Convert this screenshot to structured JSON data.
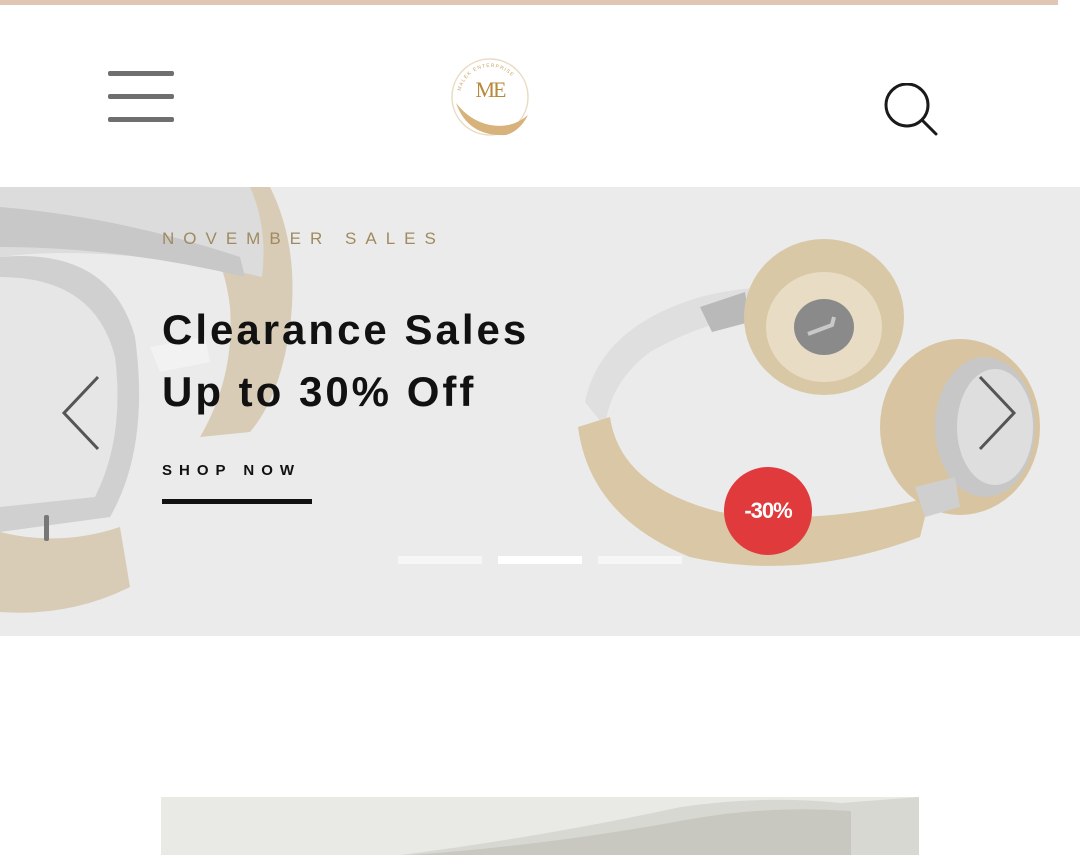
{
  "header": {
    "logo_letters": "ME",
    "logo_ring_text": "MALEK ENTERPRISE"
  },
  "hero": {
    "eyebrow": "NOVEMBER SALES",
    "headline_line1": "Clearance Sales",
    "headline_line2": "Up to 30% Off",
    "cta_label": "SHOP NOW",
    "badge": "-30%",
    "slides_count": 3,
    "active_slide": 2
  },
  "colors": {
    "top_bar": "#e2c6b4",
    "hero_bg": "#ebebeb",
    "eyebrow": "#a08a5f",
    "badge": "#e03a3c",
    "logo_gold": "#b7893a"
  },
  "icons": {
    "menu": "hamburger-icon",
    "search": "search-icon",
    "prev": "chevron-left-icon",
    "next": "chevron-right-icon"
  }
}
